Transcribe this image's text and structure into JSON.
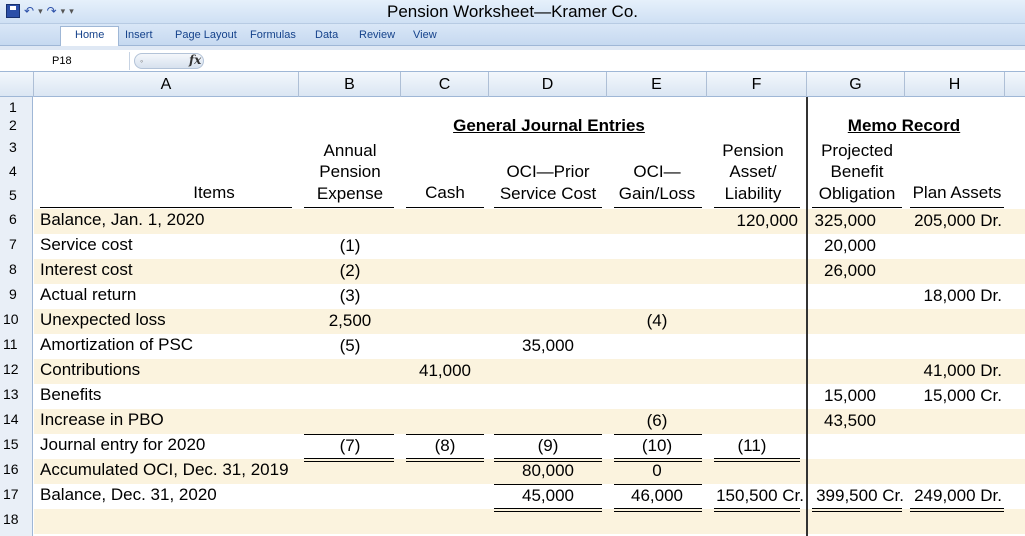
{
  "window": {
    "title": "Pension Worksheet—Kramer Co."
  },
  "ribbon": {
    "tabs": [
      "Home",
      "Insert",
      "Page Layout",
      "Formulas",
      "Data",
      "Review",
      "View"
    ]
  },
  "formula_bar": {
    "name_box": "P18",
    "fx": "fx"
  },
  "columns": [
    "A",
    "B",
    "C",
    "D",
    "E",
    "F",
    "G",
    "H"
  ],
  "rows": [
    "1",
    "2",
    "3",
    "4",
    "5",
    "6",
    "7",
    "8",
    "9",
    "10",
    "11",
    "12",
    "13",
    "14",
    "15",
    "16",
    "17",
    "18"
  ],
  "headers": {
    "general_journal": "General Journal Entries",
    "memo_record": "Memo Record",
    "items": "Items",
    "b": [
      "Annual",
      "Pension",
      "Expense"
    ],
    "c": "Cash",
    "d": [
      "OCI—Prior",
      "Service Cost"
    ],
    "e": [
      "OCI—",
      "Gain/Loss"
    ],
    "f": [
      "Pension",
      "Asset/",
      "Liability"
    ],
    "g": [
      "Projected",
      "Benefit",
      "Obligation"
    ],
    "h": "Plan Assets"
  },
  "table": [
    {
      "item": "Balance, Jan. 1, 2020",
      "b": "",
      "c": "",
      "d": "",
      "e": "",
      "f": "120,000",
      "g": "325,000",
      "h": "205,000 Dr."
    },
    {
      "item": "Service cost",
      "b": "(1)",
      "c": "",
      "d": "",
      "e": "",
      "f": "",
      "g": "20,000",
      "h": ""
    },
    {
      "item": "Interest cost",
      "b": "(2)",
      "c": "",
      "d": "",
      "e": "",
      "f": "",
      "g": "26,000",
      "h": ""
    },
    {
      "item": "Actual return",
      "b": "(3)",
      "c": "",
      "d": "",
      "e": "",
      "f": "",
      "g": "",
      "h": "18,000 Dr."
    },
    {
      "item": "Unexpected loss",
      "b": "2,500",
      "c": "",
      "d": "",
      "e": "(4)",
      "f": "",
      "g": "",
      "h": ""
    },
    {
      "item": "Amortization of PSC",
      "b": "(5)",
      "c": "",
      "d": "35,000",
      "e": "",
      "f": "",
      "g": "",
      "h": ""
    },
    {
      "item": "Contributions",
      "b": "",
      "c": "41,000",
      "d": "",
      "e": "",
      "f": "",
      "g": "",
      "h": "41,000 Dr."
    },
    {
      "item": "Benefits",
      "b": "",
      "c": "",
      "d": "",
      "e": "",
      "f": "",
      "g": "15,000",
      "h": "15,000 Cr."
    },
    {
      "item": "Increase in PBO",
      "b": "",
      "c": "",
      "d": "",
      "e": "(6)",
      "f": "",
      "g": "43,500",
      "h": ""
    },
    {
      "item": "Journal entry for 2020",
      "b": "(7)",
      "c": "(8)",
      "d": "(9)",
      "e": "(10)",
      "f": "(11)",
      "g": "",
      "h": ""
    },
    {
      "item": "Accumulated OCI, Dec. 31, 2019",
      "b": "",
      "c": "",
      "d": "80,000",
      "e": "0",
      "f": "",
      "g": "",
      "h": ""
    },
    {
      "item": "Balance, Dec. 31, 2020",
      "b": "",
      "c": "",
      "d": "45,000",
      "e": "46,000",
      "f": "150,500 Cr.",
      "g": "399,500 Cr.",
      "h": "249,000 Dr."
    }
  ],
  "colors": {
    "row_band": "#fbf3de",
    "ribbon": "#c6d9f0",
    "header_text": "#15428b"
  }
}
